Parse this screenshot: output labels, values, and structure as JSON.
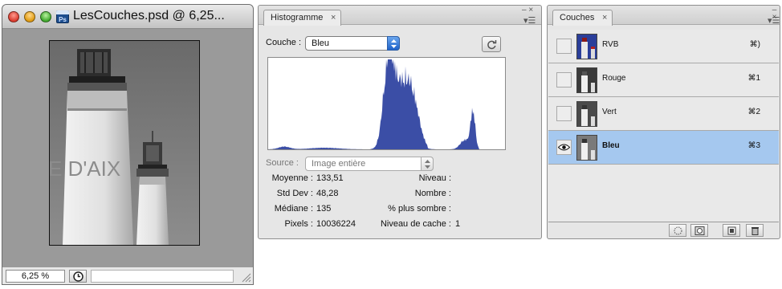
{
  "document": {
    "title": "LesCouches.psd @ 6,25...",
    "image_text": "E D'AIX",
    "zoom": "6,25 %"
  },
  "histogram": {
    "tab_label": "Histogramme",
    "close_glyph": "×",
    "couche_label": "Couche :",
    "couche_value": "Bleu",
    "source_label": "Source :",
    "source_value": "Image entière",
    "stats_left": [
      {
        "label": "Moyenne :",
        "value": "133,51"
      },
      {
        "label": "Std Dev :",
        "value": "48,28"
      },
      {
        "label": "Médiane :",
        "value": "135"
      },
      {
        "label": "Pixels :",
        "value": "10036224"
      }
    ],
    "stats_right": [
      {
        "label": "Niveau :",
        "value": ""
      },
      {
        "label": "Nombre :",
        "value": ""
      },
      {
        "label": "% plus sombre :",
        "value": ""
      },
      {
        "label": "Niveau de cache :",
        "value": "1"
      }
    ],
    "graph_color": "#3b4ea6"
  },
  "channels": {
    "tab_label": "Couches",
    "close_glyph": "×",
    "selected_color": "#a5c8ef",
    "items": [
      {
        "name": "RVB",
        "shortcut": "⌘)",
        "visible": false,
        "selected": false
      },
      {
        "name": "Rouge",
        "shortcut": "⌘1",
        "visible": false,
        "selected": false
      },
      {
        "name": "Vert",
        "shortcut": "⌘2",
        "visible": false,
        "selected": false
      },
      {
        "name": "Bleu",
        "shortcut": "⌘3",
        "visible": true,
        "selected": true
      }
    ]
  }
}
